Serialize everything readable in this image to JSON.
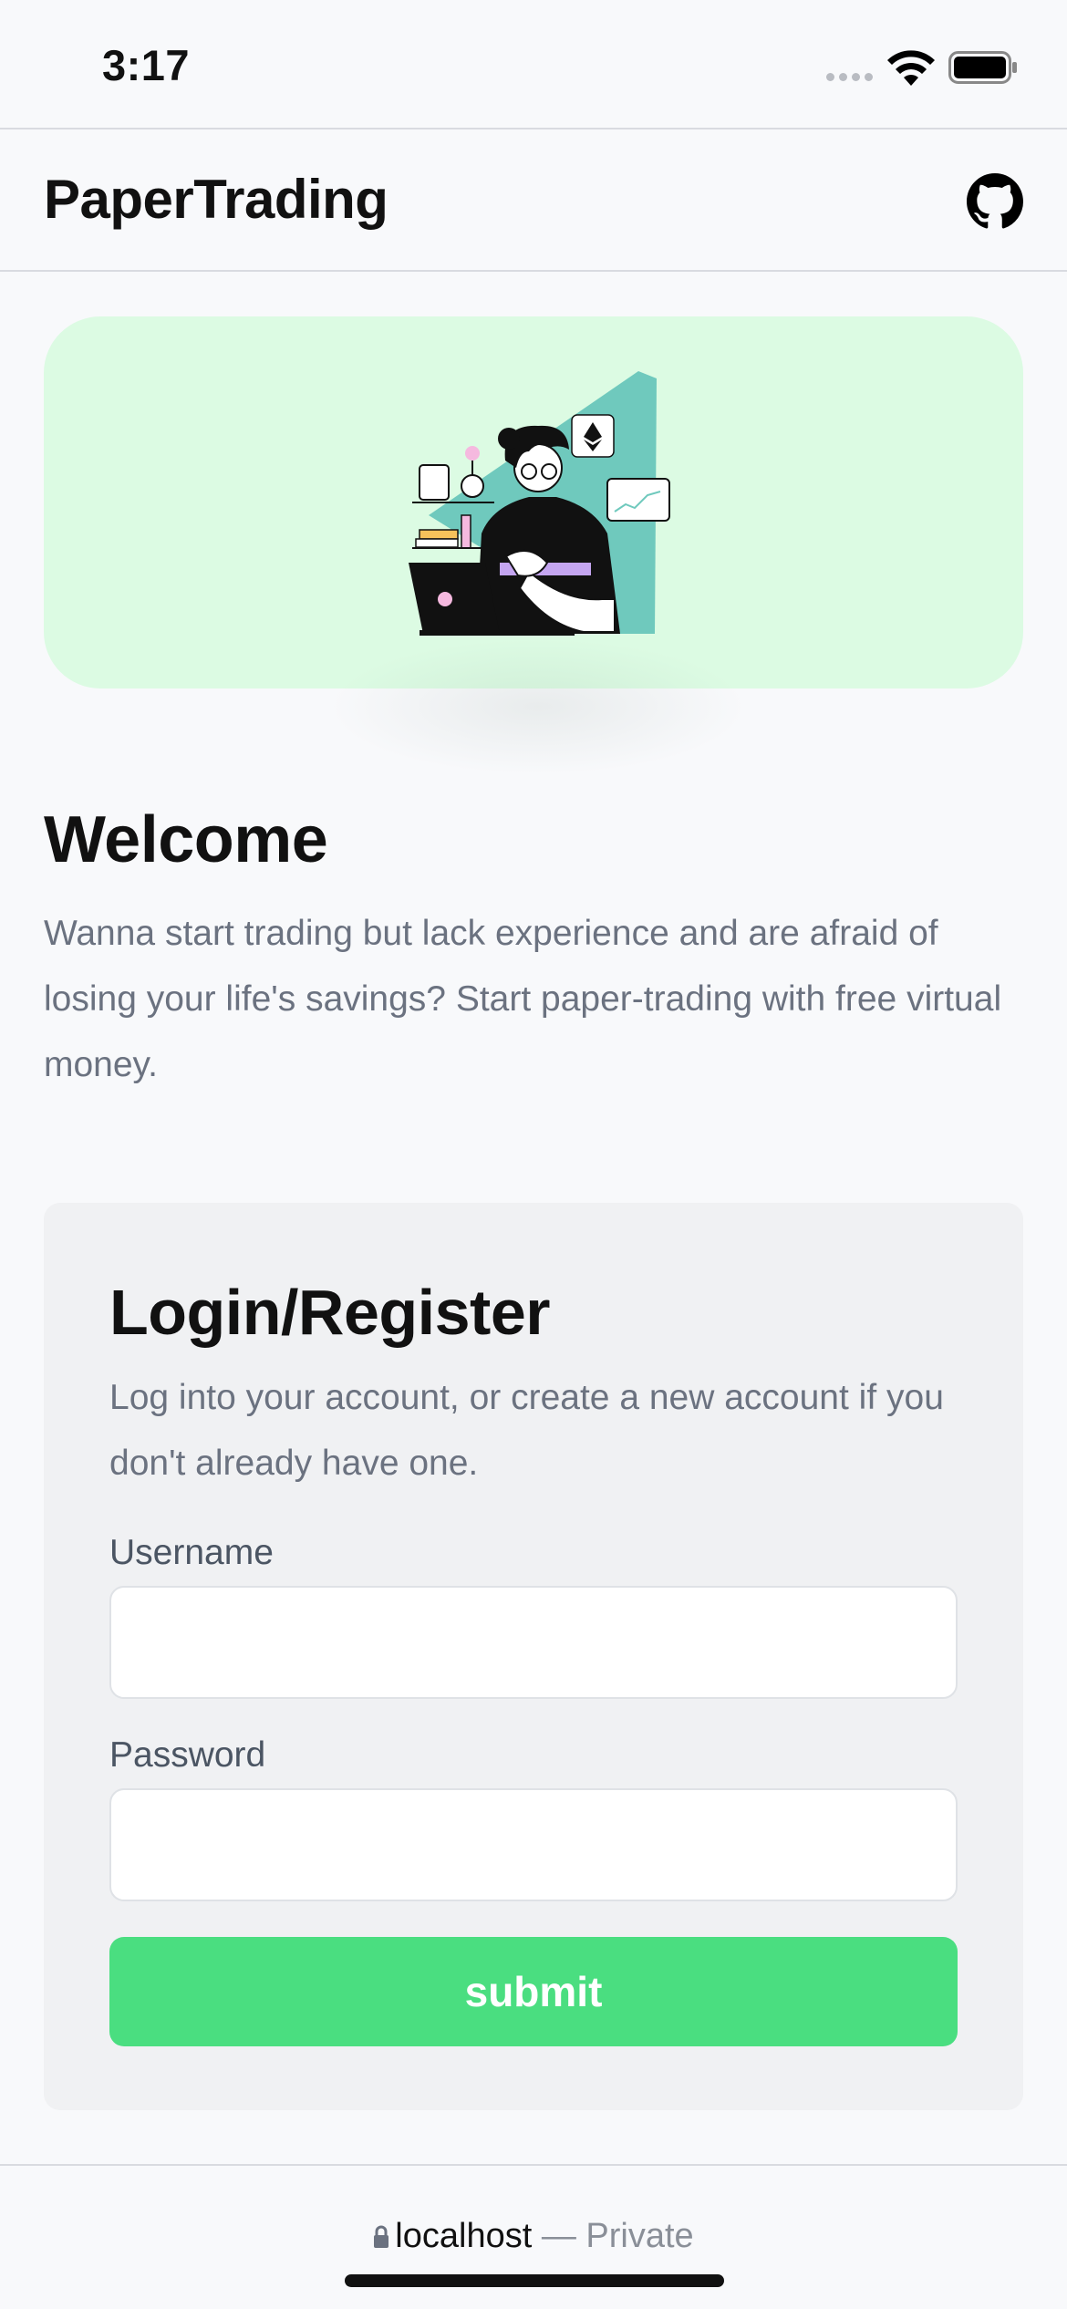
{
  "status_bar": {
    "time": "3:17"
  },
  "header": {
    "title": "PaperTrading",
    "github_icon": "github-icon"
  },
  "hero": {
    "illustration": "person-with-laptop-illustration",
    "bg_color": "#dcfbe3"
  },
  "welcome": {
    "title": "Welcome",
    "text": "Wanna start trading but lack experience and are afraid of losing your life's savings? Start paper-trading with free virtual money."
  },
  "login": {
    "title": "Login/Register",
    "text": "Log into your account, or create a new account if you don't already have one.",
    "username_label": "Username",
    "username_value": "",
    "password_label": "Password",
    "password_value": "",
    "submit_label": "submit",
    "submit_color": "#4ade80"
  },
  "browser": {
    "host": "localhost",
    "separator": " — ",
    "mode": "Private",
    "lock_icon": "lock-icon"
  }
}
